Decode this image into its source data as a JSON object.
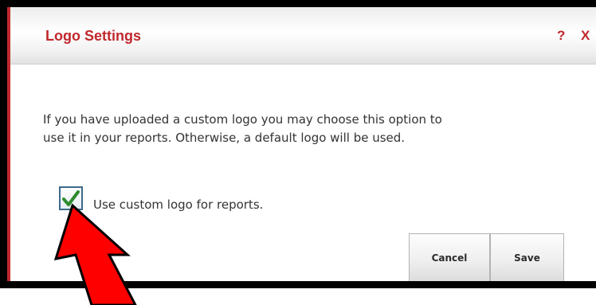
{
  "dialog": {
    "title": "Logo Settings",
    "help_label": "?",
    "close_label": "X",
    "message_line1": "If you have uploaded a custom logo you may choose this option to",
    "message_line2": "use it in your reports. Otherwise, a default logo will be used.",
    "checkbox": {
      "label": "Use custom logo for reports.",
      "checked": true
    },
    "buttons": {
      "cancel_label": "Cancel",
      "save_label": "Save"
    }
  },
  "colors": {
    "title_red": "#c0282d",
    "check_green": "#2e8b2e",
    "annotation_arrow": "#ff0000"
  },
  "icons": {
    "checkmark": "check-icon",
    "annotation": "arrow-up-icon"
  }
}
